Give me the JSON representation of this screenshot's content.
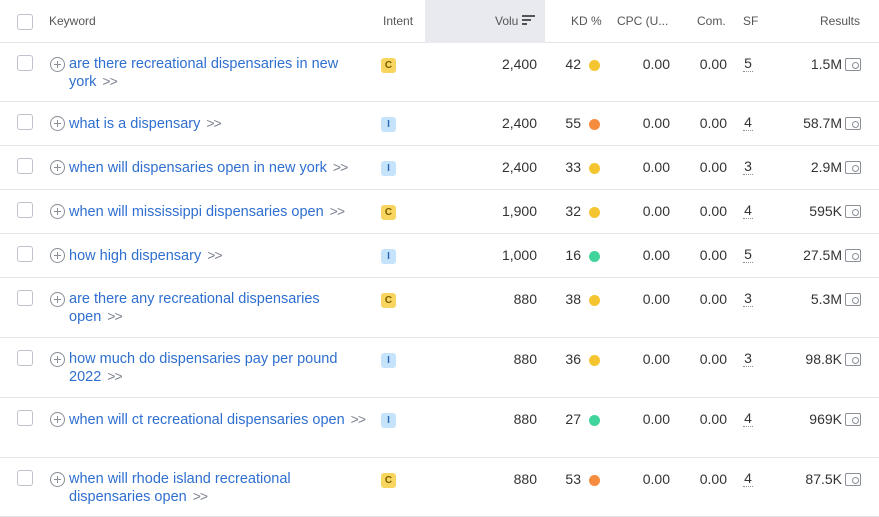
{
  "header": {
    "keyword": "Keyword",
    "intent": "Intent",
    "volume": "Volu",
    "kd": "KD %",
    "cpc": "CPC (U...",
    "com": "Com.",
    "sf": "SF",
    "results": "Results"
  },
  "colors": {
    "link": "#2f6fd0",
    "dot_yellow": "#f5c531",
    "dot_orange": "#f58b3c",
    "dot_green": "#40d39a",
    "badge_commercial": "#f8d55f",
    "badge_informational": "#c5e3fb"
  },
  "rows": [
    {
      "line1": "are there recreational dispensaries in new",
      "line2": "york",
      "intent": "C",
      "volume": "2,400",
      "kd": "42",
      "kd_color": "yellow",
      "cpc": "0.00",
      "com": "0.00",
      "sf": "5",
      "results": "1.5M"
    },
    {
      "line1": "what is a dispensary",
      "line2": "",
      "intent": "I",
      "volume": "2,400",
      "kd": "55",
      "kd_color": "orange",
      "cpc": "0.00",
      "com": "0.00",
      "sf": "4",
      "results": "58.7M"
    },
    {
      "line1": "when will dispensaries open in new york",
      "line2": "",
      "intent": "I",
      "volume": "2,400",
      "kd": "33",
      "kd_color": "yellow",
      "cpc": "0.00",
      "com": "0.00",
      "sf": "3",
      "results": "2.9M"
    },
    {
      "line1": "when will mississippi dispensaries open",
      "line2": "",
      "intent": "C",
      "volume": "1,900",
      "kd": "32",
      "kd_color": "yellow",
      "cpc": "0.00",
      "com": "0.00",
      "sf": "4",
      "results": "595K"
    },
    {
      "line1": "how high dispensary",
      "line2": "",
      "intent": "I",
      "volume": "1,000",
      "kd": "16",
      "kd_color": "green",
      "cpc": "0.00",
      "com": "0.00",
      "sf": "5",
      "results": "27.5M"
    },
    {
      "line1": "are there any recreational dispensaries",
      "line2": "open",
      "intent": "C",
      "volume": "880",
      "kd": "38",
      "kd_color": "yellow",
      "cpc": "0.00",
      "com": "0.00",
      "sf": "3",
      "results": "5.3M"
    },
    {
      "line1": "how much do dispensaries pay per pound",
      "line2": "2022",
      "intent": "I",
      "volume": "880",
      "kd": "36",
      "kd_color": "yellow",
      "cpc": "0.00",
      "com": "0.00",
      "sf": "3",
      "results": "98.8K"
    },
    {
      "line1": "when will ct recreational dispensaries open",
      "line2": "",
      "intent": "I",
      "volume": "880",
      "kd": "27",
      "kd_color": "green",
      "cpc": "0.00",
      "com": "0.00",
      "sf": "4",
      "results": "969K"
    },
    {
      "line1": "when will rhode island recreational",
      "line2": "dispensaries open",
      "intent": "C",
      "volume": "880",
      "kd": "53",
      "kd_color": "orange",
      "cpc": "0.00",
      "com": "0.00",
      "sf": "4",
      "results": "87.5K"
    }
  ]
}
